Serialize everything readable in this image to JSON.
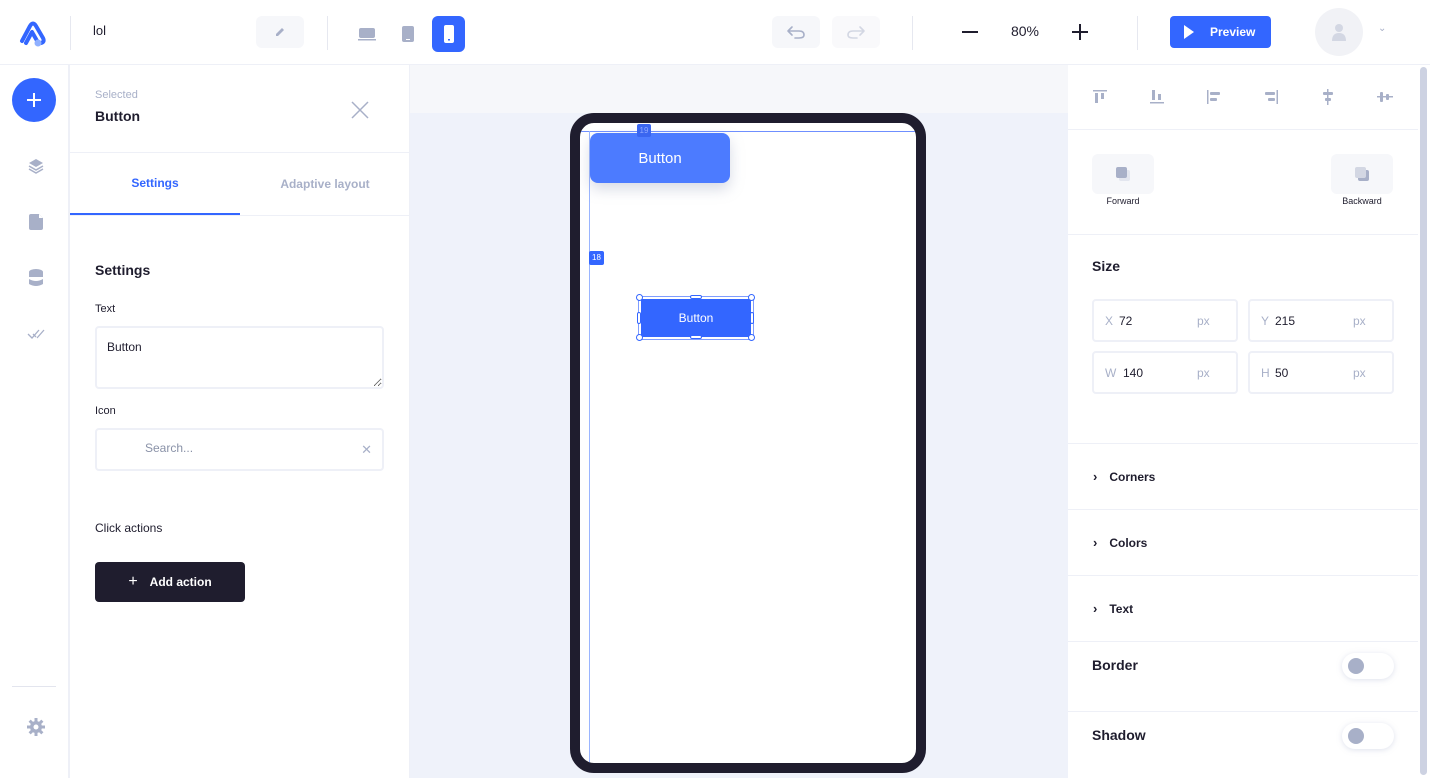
{
  "topbar": {
    "project_name": "lol",
    "zoom_value": "80%",
    "preview_label": "Preview",
    "active_device": "mobile",
    "devices": [
      "desktop",
      "tablet",
      "mobile"
    ]
  },
  "rail": {
    "items": [
      "add",
      "layers",
      "pages",
      "database",
      "checks",
      "settings"
    ]
  },
  "left_panel": {
    "selected_label": "Selected",
    "selected_name": "Button",
    "tabs": [
      {
        "label": "Settings",
        "active": true
      },
      {
        "label": "Adaptive layout",
        "active": false
      }
    ],
    "section_title": "Settings",
    "text_label": "Text",
    "text_value": "Button",
    "icon_label": "Icon",
    "icon_placeholder": "Search...",
    "click_actions_label": "Click actions",
    "add_action_label": "Add action"
  },
  "canvas": {
    "ghost_button_text": "Button",
    "ghost_badge": "19",
    "distance_badge": "18",
    "selected_button_text": "Button"
  },
  "right_panel": {
    "align_tools": [
      "align-top",
      "align-bottom",
      "align-left",
      "align-right",
      "align-center-vertical",
      "align-center-horizontal"
    ],
    "forward_label": "Forward",
    "backward_label": "Backward",
    "size_title": "Size",
    "fields": [
      {
        "axis": "X",
        "value": "72",
        "unit": "px"
      },
      {
        "axis": "Y",
        "value": "215",
        "unit": "px"
      },
      {
        "axis": "W",
        "value": "140",
        "unit": "px"
      },
      {
        "axis": "H",
        "value": "50",
        "unit": "px"
      }
    ],
    "sections": [
      {
        "label": "Corners"
      },
      {
        "label": "Colors"
      },
      {
        "label": "Text"
      }
    ],
    "toggles": [
      {
        "label": "Border",
        "on": false
      },
      {
        "label": "Shadow",
        "on": false
      }
    ]
  },
  "colors": {
    "accent": "#3366ff",
    "dark": "#1f1d2e",
    "muted": "#a8b0c8"
  }
}
